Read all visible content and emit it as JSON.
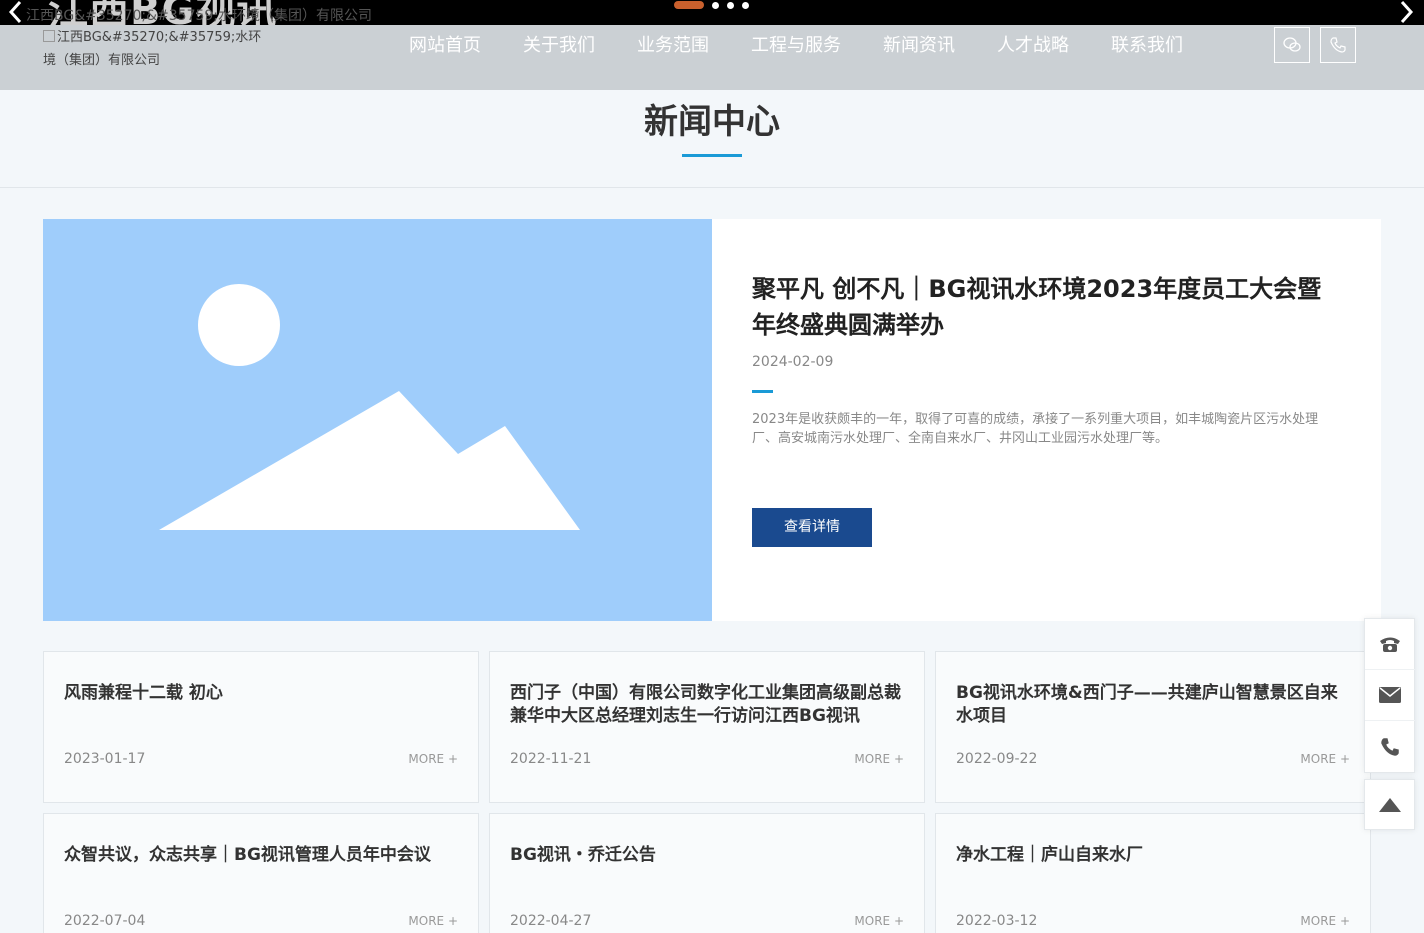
{
  "banner": {
    "title": "江西BG视讯",
    "subtitle": "江西BG&#35270;&#35759;水环境（集团）有限公司"
  },
  "header": {
    "logo_alt": "江西BG&#35270;&#35759;水环境（集团）有限公司",
    "nav": [
      "网站首页",
      "关于我们",
      "业务范围",
      "工程与服务",
      "新闻资讯",
      "人才战略",
      "联系我们"
    ],
    "wechat_icon": "wechat-icon",
    "phone_icon": "phone-icon"
  },
  "section": {
    "title": "新闻中心"
  },
  "featured": {
    "title": "聚平凡 创不凡｜BG视讯水环境2023年度员工大会暨年终盛典圆满举办",
    "date": "2024-02-09",
    "summary": "2023年是收获颇丰的一年，取得了可喜的成绩，承接了一系列重大项目，如丰城陶瓷片区污水处理厂、高安城南污水处理厂、全南自来水厂、井冈山工业园污水处理厂等。",
    "button": "查看详情"
  },
  "news": [
    {
      "title": "风雨兼程十二载 初心",
      "date": "2023-01-17",
      "more": "MORE +"
    },
    {
      "title": "西门子（中国）有限公司数字化工业集团高级副总裁兼华中大区总经理刘志生一行访问江西BG视讯",
      "date": "2022-11-21",
      "more": "MORE +"
    },
    {
      "title": "BG视讯水环境&西门子——共建庐山智慧景区自来水项目",
      "date": "2022-09-22",
      "more": "MORE +"
    },
    {
      "title": "众智共议，众志共享｜BG视讯管理人员年中会议",
      "date": "2022-07-04",
      "more": "MORE +"
    },
    {
      "title": "BG视讯・乔迁公告",
      "date": "2022-04-27",
      "more": "MORE +"
    },
    {
      "title": "净水工程｜庐山自来水厂",
      "date": "2022-03-12",
      "more": "MORE +"
    }
  ],
  "colors": {
    "accent": "#1a9ad6",
    "button": "#1a4a8f",
    "slider_active": "#c9602d",
    "header_bg": "#cbd0d4"
  }
}
